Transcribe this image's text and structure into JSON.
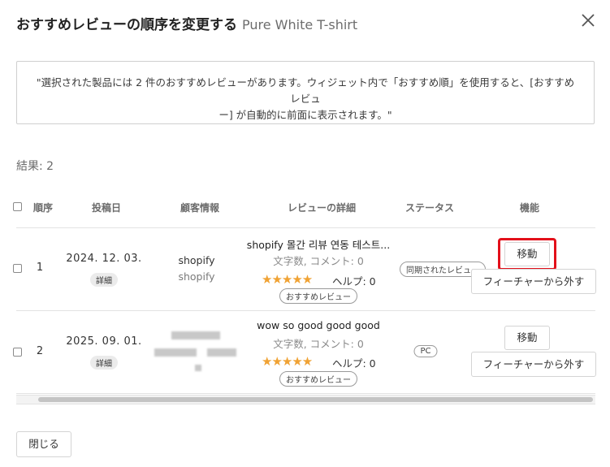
{
  "dialog": {
    "title": "おすすめレビューの順序を変更する",
    "product_name": "Pure White T-shirt",
    "notice_line1": "\"選択された製品には 2 件のおすすめレビューがあります。ウィジェット内で「おすすめ順」を使用すると、[おすすめレビュ",
    "notice_line2": "ー] が自動的に前面に表示されます。\"",
    "results_label": "結果: 2",
    "close_button_label": "閉じる"
  },
  "table": {
    "headers": [
      "順序",
      "投稿日",
      "顧客情報",
      "レビューの詳細",
      "ステータス",
      "機能"
    ],
    "rows": [
      {
        "order": "1",
        "date": "2024. 12. 03.",
        "detail_tag": "詳細",
        "customer_name": "shopify",
        "customer_sub": "shopify",
        "review_title": "shopify 몰간 리뷰 연동 테스트...",
        "review_meta": "文字数, コメント: 0",
        "rating": 5,
        "stars": "★★★★★",
        "helpful": "ヘルプ: 0",
        "featured_tag": "おすすめレビュー",
        "status": "同期されたレビュー",
        "move_label": "移動",
        "unfeature_label": "フィーチャーから外す"
      },
      {
        "order": "2",
        "date": "2025. 09. 01.",
        "detail_tag": "詳細",
        "customer_name": "",
        "customer_sub": "",
        "review_title": "wow so good good good",
        "review_meta": "文字数, コメント: 0",
        "rating": 5,
        "stars": "★★★★★",
        "helpful": "ヘルプ: 0",
        "featured_tag": "おすすめレビュー",
        "status": "PC",
        "move_label": "移動",
        "unfeature_label": "フィーチャーから外す"
      }
    ]
  },
  "colors": {
    "highlight": "#e3101a",
    "star": "#f0a233"
  },
  "icons": {
    "close": "close-icon",
    "star": "star-icon"
  }
}
